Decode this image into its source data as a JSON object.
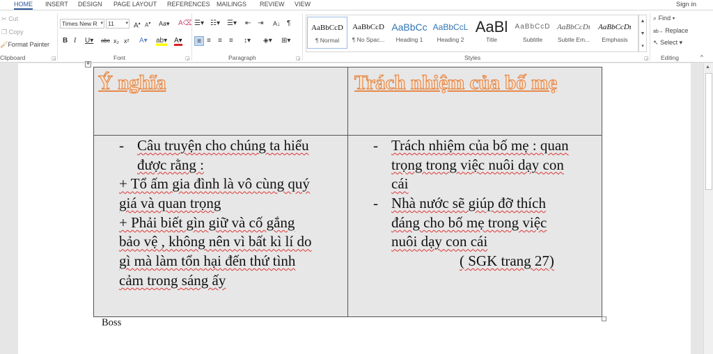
{
  "tabs": [
    "HOME",
    "INSERT",
    "DESIGN",
    "PAGE LAYOUT",
    "REFERENCES",
    "MAILINGS",
    "REVIEW",
    "VIEW"
  ],
  "signin": "Sign in",
  "clipboard": {
    "cut": "Cut",
    "copy": "Copy",
    "format_painter": "Format Painter",
    "label": "Clipboard"
  },
  "font": {
    "name": "Times New R",
    "size": "11",
    "label": "Font"
  },
  "paragraph": {
    "label": "Paragraph"
  },
  "styles": {
    "label": "Styles",
    "items": [
      {
        "preview": "AaBbCcD",
        "name": "¶ Normal"
      },
      {
        "preview": "AaBbCcD",
        "name": "¶ No Spac..."
      },
      {
        "preview": "AaBbCc",
        "name": "Heading 1"
      },
      {
        "preview": "AaBbCcL",
        "name": "Heading 2"
      },
      {
        "preview": "AaBl",
        "name": "Title"
      },
      {
        "preview": "AaBbCcD",
        "name": "Subtitle"
      },
      {
        "preview": "AaBbCcDı",
        "name": "Subtle Em..."
      },
      {
        "preview": "AaBbCcDı",
        "name": "Emphasis"
      }
    ]
  },
  "editing": {
    "find": "Find",
    "replace": "Replace",
    "select": "Select",
    "label": "Editing"
  },
  "colors": {
    "accent": "#2b579a",
    "heading_fill": "#fbe3cf",
    "heading_stroke": "#e58a4b",
    "table_bg": "#e7e7e7"
  },
  "document": {
    "table": {
      "headers": [
        "Ý nghĩa",
        "Trách nhiệm của bố mẹ"
      ],
      "left_lines": [
        "Câu truyện cho chúng ta hiểu",
        "được rằng :",
        "+ Tổ ấm gia đình là vô cùng quý",
        "giá và quan trọng",
        "+ Phải biết gìn giữ và cố gắng",
        "bảo vệ , không nên vì bất kì lí do",
        "gì mà làm tổn hại đến thứ tình",
        "cảm trong sáng ấy"
      ],
      "right_lines": [
        "Trách nhiệm của bố mẹ : quan",
        "trọng trong việc nuôi dạy con",
        "cái",
        "Nhà nước sẽ giúp đỡ thích",
        "đáng cho bố mẹ trong việc",
        "nuôi dạy con cái",
        "( SGK trang 27)"
      ],
      "bullet": "-"
    },
    "after_table": "Boss"
  }
}
